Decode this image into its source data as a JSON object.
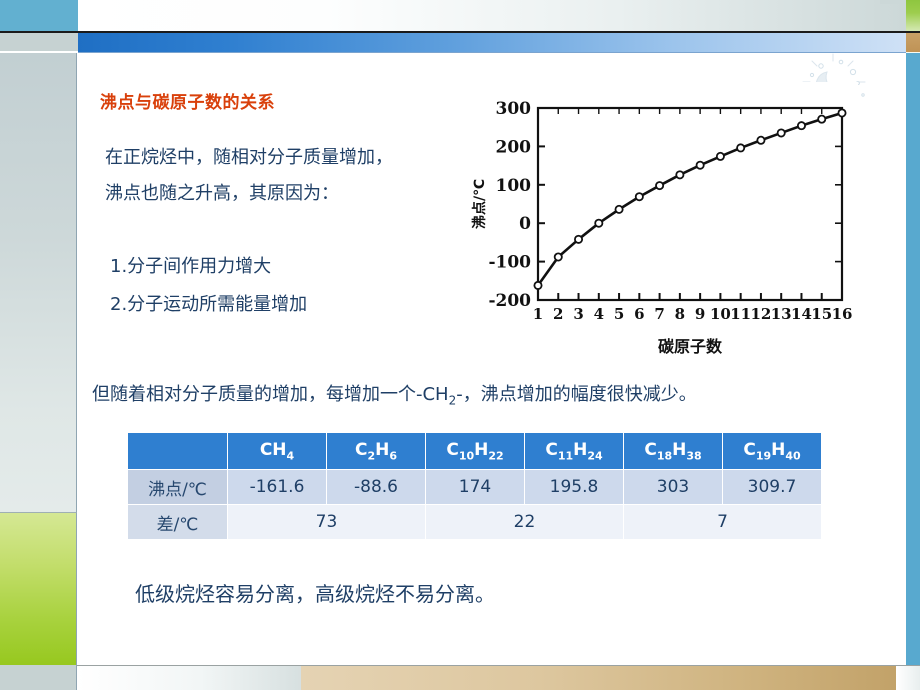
{
  "slide": {
    "title": "沸点与碳原子数的关系",
    "paragraph_1": [
      "在正烷烃中，随相对分子质量增加，",
      "沸点也随之升高，其原因为："
    ],
    "list_items": [
      "1.分子间作用力增大",
      "2.分子运动所需能量增加"
    ],
    "paragraph_2_before": "但随着相对分子质量的增加，每增加一个-CH",
    "paragraph_2_sub": "2",
    "paragraph_2_after": "-，沸点增加的幅度很快减少。",
    "paragraph_3": "低级烷烃容易分离，高级烷烃不易分离。",
    "decor": {
      "watermark": "bubbles-decoration",
      "top_bar_accent": "#2f7fd0",
      "title_color": "#d9400b",
      "body_color": "#1f3f66",
      "green_block": "#a8d23e",
      "tan_block": "#cfb37f",
      "blue_block": "#58a9cf"
    }
  },
  "table": {
    "headers": [
      "",
      "CH4",
      "C2H6",
      "C10H22",
      "C11H24",
      "C18H38",
      "C19H40"
    ],
    "headers_parts": [
      {
        "main": "",
        "sub": ""
      },
      {
        "pre": "CH",
        "sub": "4"
      },
      {
        "pre": "C",
        "sub": "2",
        "mid": "H",
        "sub2": "6"
      },
      {
        "pre": "C",
        "sub": "10",
        "mid": "H",
        "sub2": "22"
      },
      {
        "pre": "C",
        "sub": "11",
        "mid": "H",
        "sub2": "24"
      },
      {
        "pre": "C",
        "sub": "18",
        "mid": "H",
        "sub2": "38"
      },
      {
        "pre": "C",
        "sub": "19",
        "mid": "H",
        "sub2": "40"
      }
    ],
    "row1_label": "沸点/℃",
    "row1_values": [
      "-161.6",
      "-88.6",
      "174",
      "195.8",
      "303",
      "309.7"
    ],
    "row2_label": "差/℃",
    "row2_values": [
      "73",
      "22",
      "7"
    ]
  },
  "chart_data": {
    "type": "line",
    "title": "",
    "xlabel": "碳原子数",
    "ylabel": "沸点/℃",
    "xlim": [
      1,
      16
    ],
    "ylim": [
      -200,
      300
    ],
    "xticks": [
      1,
      2,
      3,
      4,
      5,
      6,
      7,
      8,
      9,
      10,
      11,
      12,
      13,
      14,
      15,
      16
    ],
    "yticks": [
      -200,
      -100,
      0,
      100,
      200,
      300
    ],
    "ytick_labels": [
      "-200",
      "-100",
      "0",
      "100",
      "200",
      "300"
    ],
    "grid": false,
    "legend": null,
    "marker": "open-circle",
    "x": [
      1,
      2,
      3,
      4,
      5,
      6,
      7,
      8,
      9,
      10,
      11,
      12,
      13,
      14,
      15,
      16
    ],
    "values": [
      -162,
      -88,
      -42,
      0,
      36,
      69,
      98,
      126,
      151,
      174,
      196,
      216,
      235,
      254,
      271,
      287
    ]
  }
}
